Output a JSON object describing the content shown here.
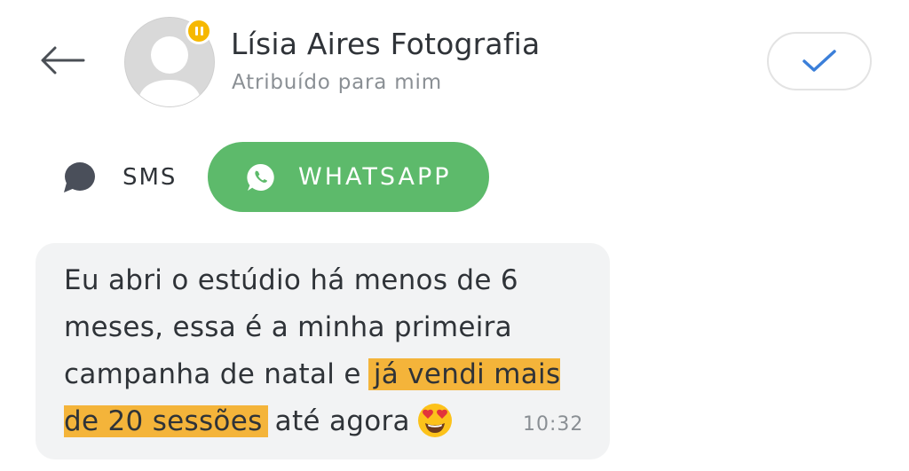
{
  "header": {
    "back_icon": "arrow-left-icon",
    "contact_name": "Lísia Aires Fotografia",
    "assignment": "Atribuído para mim",
    "status_badge_icon": "pause-icon",
    "status_badge_color": "#f6b800",
    "resolve_icon": "check-icon",
    "accent_color": "#3b7fd9"
  },
  "channels": {
    "sms": {
      "label": "SMS",
      "icon": "chat-bubble-icon"
    },
    "whatsapp": {
      "label": "WHATSAPP",
      "icon": "whatsapp-icon",
      "active": true,
      "color": "#5dba6b"
    }
  },
  "message": {
    "text_before": "Eu abri o estúdio há menos de 6 meses, essa é a minha primeira campanha de natal e ",
    "highlight": "já vendi mais de 20 sessões",
    "text_after": " até agora",
    "emoji": "heart-eyes-emoji",
    "time": "10:32",
    "highlight_color": "#f4b43a"
  }
}
